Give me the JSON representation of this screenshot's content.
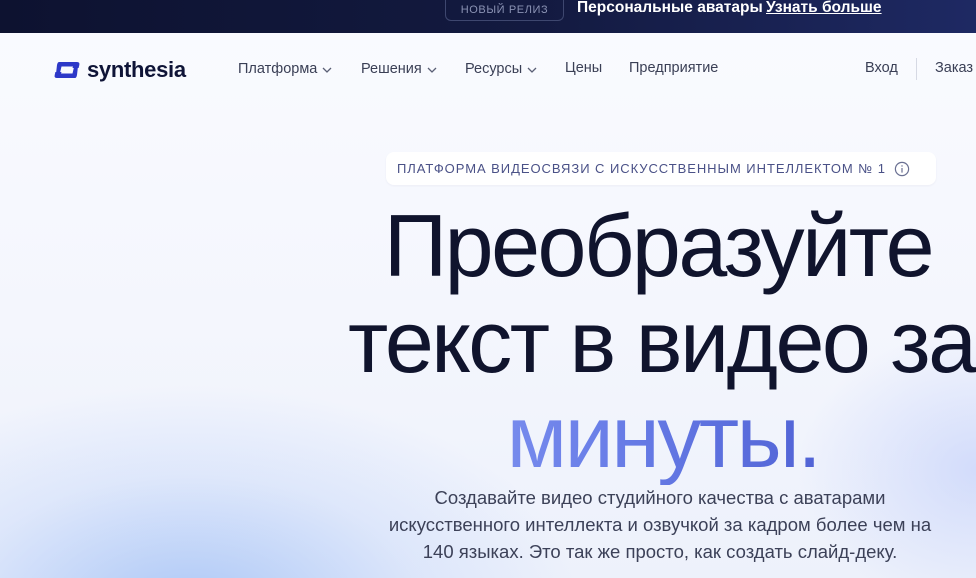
{
  "announcement": {
    "badge": "НОВЫЙ РЕЛИЗ",
    "message": "Персональные аватары",
    "link": "Узнать больше"
  },
  "header": {
    "logo_text": "synthesia",
    "nav": [
      {
        "label": "Платформа",
        "has_dropdown": true
      },
      {
        "label": "Решения",
        "has_dropdown": true
      },
      {
        "label": "Ресурсы",
        "has_dropdown": true
      },
      {
        "label": "Цены",
        "has_dropdown": false
      },
      {
        "label": "Предприятие",
        "has_dropdown": false
      }
    ],
    "login": "Вход",
    "cta": "Заказ"
  },
  "hero": {
    "eyebrow": "ПЛАТФОРМА ВИДЕОСВЯЗИ С ИСКУССТВЕННЫМ ИНТЕЛЛЕКТОМ № 1",
    "title_line1": "Преобразуйте",
    "title_line2": "текст в видео за",
    "title_highlight": "минуты.",
    "subtitle_line1": "Создавайте видео студийного качества с аватарами",
    "subtitle_line2": "искусственного интеллекта и озвучкой за кадром более чем на",
    "subtitle_line3": "140 языках. Это так же просто, как создать слайд-деку."
  },
  "colors": {
    "brand": "#2d38c8",
    "topbar": "#131a40",
    "highlight_start": "#8c9ef5",
    "highlight_end": "#3f4fc8"
  },
  "icons": {
    "logo": "synthesia-logo-icon",
    "dropdown": "chevron-down-icon",
    "info": "info-icon"
  }
}
